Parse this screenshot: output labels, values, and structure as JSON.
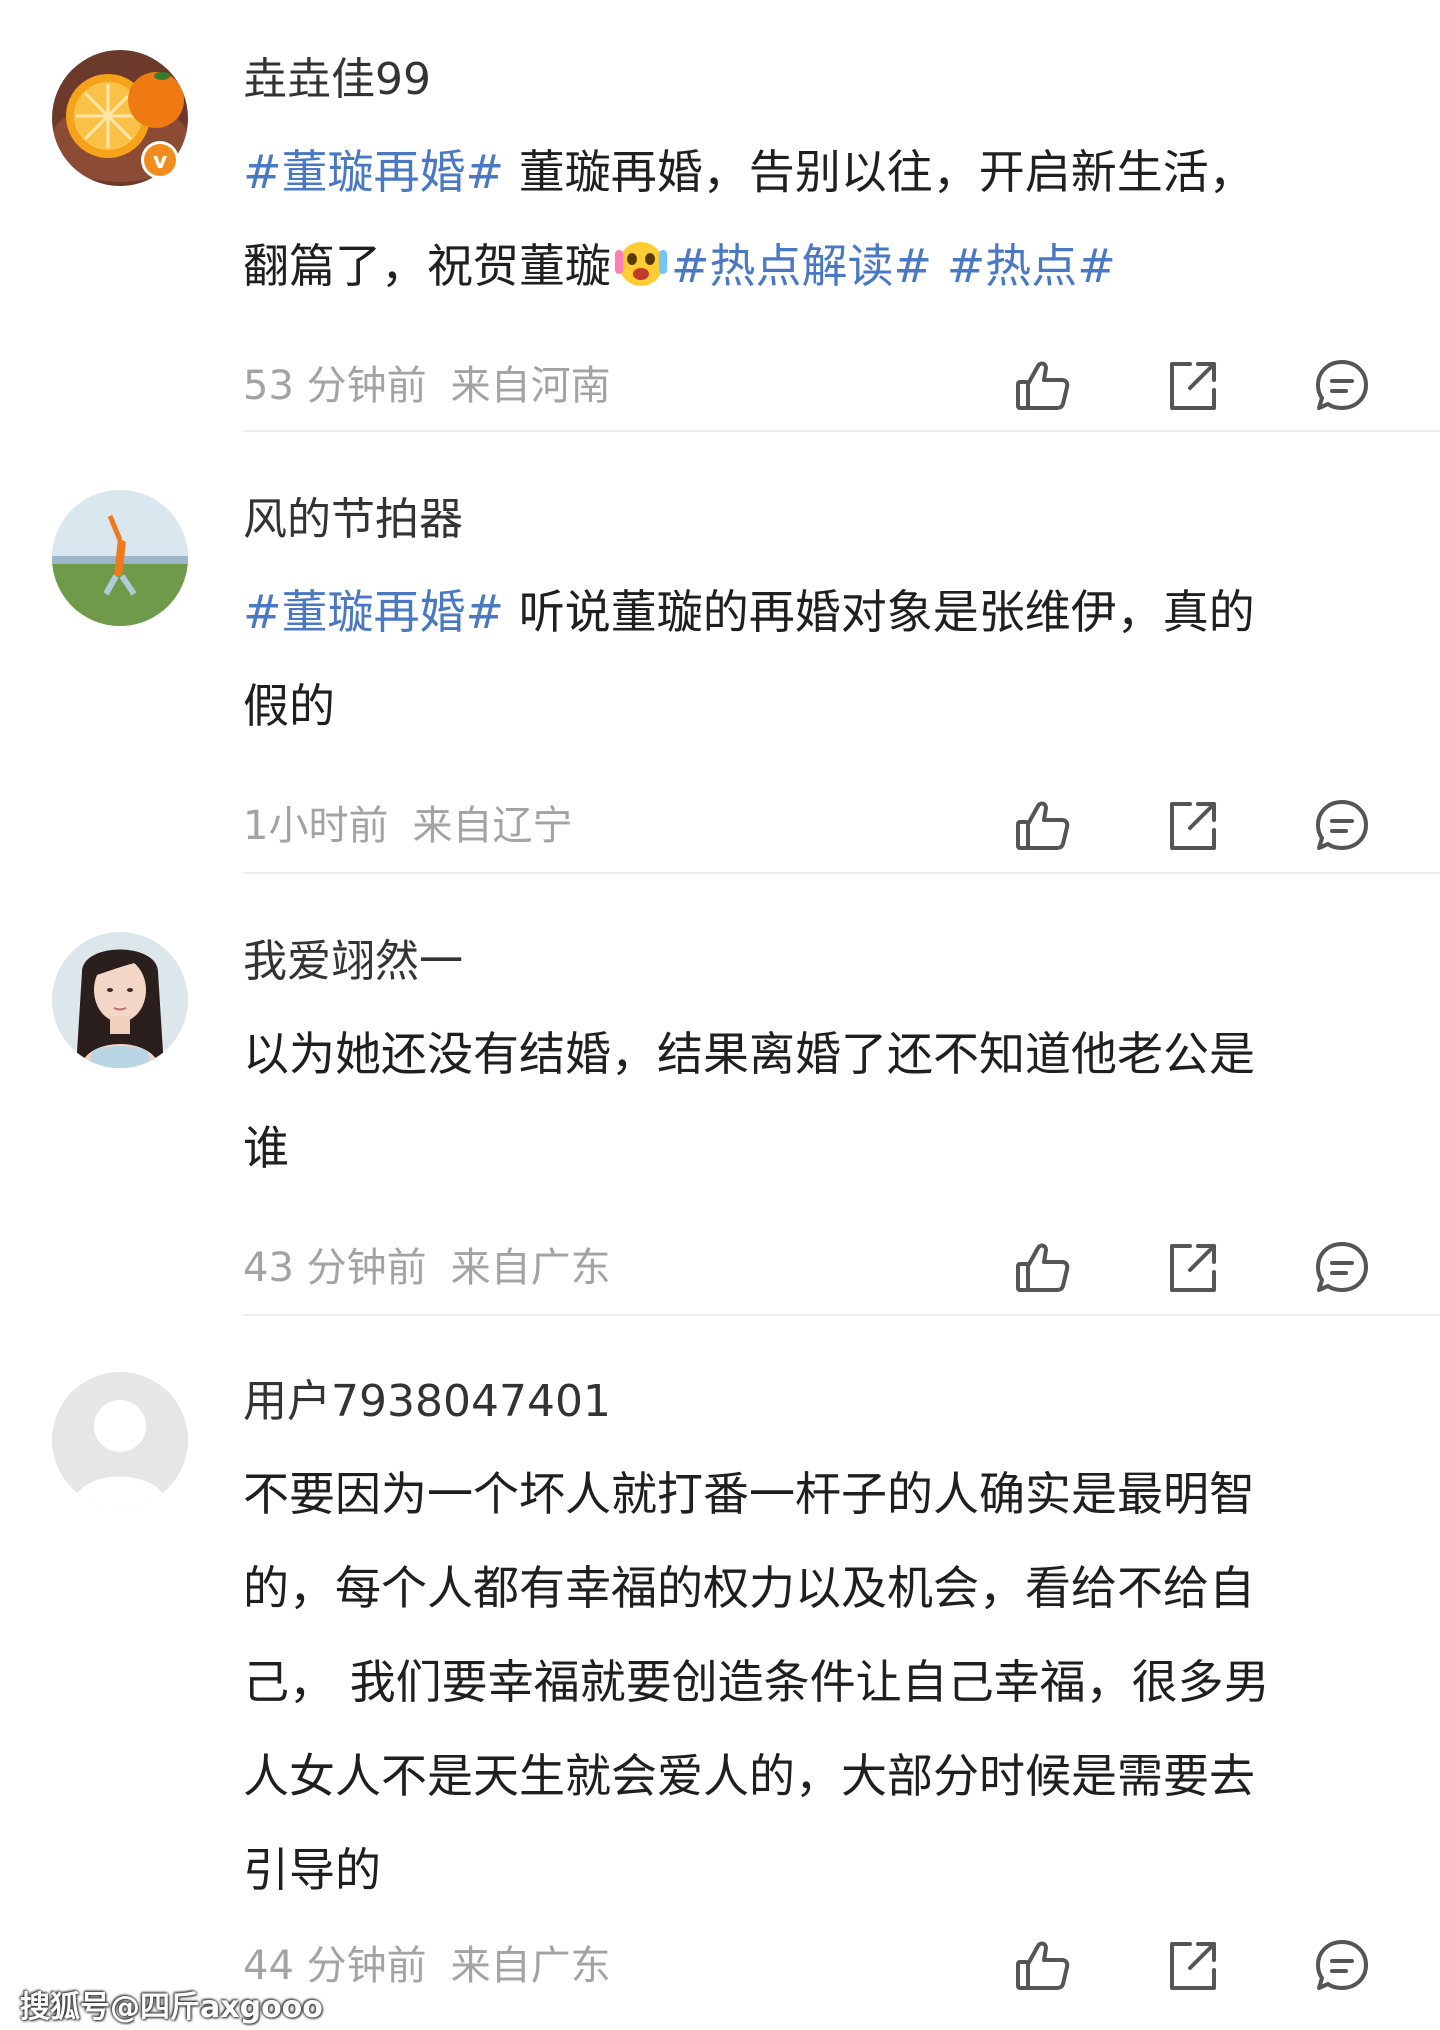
{
  "posts": [
    {
      "username": "垚垚佳99",
      "avatar": "orange-slice-avatar",
      "verified_badge": "v",
      "lines": [
        [
          {
            "t": "#董璇再婚#",
            "tag": true
          },
          {
            "t": " 董璇再婚，告别以往，开启新生活，",
            "tag": false
          }
        ],
        [
          {
            "t": "翻篇了，祝贺董璇",
            "tag": false
          },
          {
            "emoji": "excited-face-emoji"
          },
          {
            "t": "#热点解读#",
            "tag": true
          },
          {
            "t": " ",
            "tag": false
          },
          {
            "t": "#热点#",
            "tag": true
          }
        ]
      ],
      "time": "53 分钟前",
      "location": "来自河南"
    },
    {
      "username": "风的节拍器",
      "avatar": "grassland-person-avatar",
      "lines": [
        [
          {
            "t": "#董璇再婚#",
            "tag": true
          },
          {
            "t": " 听说董璇的再婚对象是张维伊，真的",
            "tag": false
          }
        ],
        [
          {
            "t": "假的",
            "tag": false
          }
        ]
      ],
      "time": "1小时前",
      "location": "来自辽宁"
    },
    {
      "username": "我爱翊然一",
      "avatar": "woman-portrait-avatar",
      "lines": [
        [
          {
            "t": "以为她还没有结婚，结果离婚了还不知道他老公是",
            "tag": false
          }
        ],
        [
          {
            "t": "谁",
            "tag": false
          }
        ]
      ],
      "time": "43 分钟前",
      "location": "来自广东"
    },
    {
      "username": "用户7938047401",
      "avatar": "default-user-avatar",
      "lines": [
        [
          {
            "t": "不要因为一个坏人就打番一杆子的人确实是最明智",
            "tag": false
          }
        ],
        [
          {
            "t": "的，每个人都有幸福的权力以及机会，看给不给自",
            "tag": false
          }
        ],
        [
          {
            "t": "己， 我们要幸福就要创造条件让自己幸福，很多男",
            "tag": false
          }
        ],
        [
          {
            "t": "人女人不是天生就会爱人的，大部分时候是需要去",
            "tag": false
          }
        ],
        [
          {
            "t": "引导的",
            "tag": false
          }
        ]
      ],
      "time": "44 分钟前",
      "location": "来自广东"
    }
  ],
  "icons": {
    "like": "thumbs-up-icon",
    "share": "share-icon",
    "comment": "comment-icon"
  },
  "colors": {
    "hashtag": "#4a78c2",
    "meta": "#a3a3a3",
    "text": "#1f1f1f",
    "icon": "#555555",
    "verified_badge": "#f28c1c"
  },
  "watermark": "搜狐号@四斤axgooo"
}
